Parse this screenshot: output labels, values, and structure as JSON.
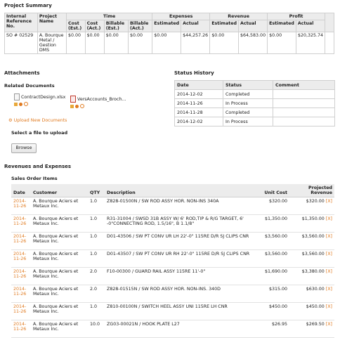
{
  "project_summary": {
    "title": "Project Summary",
    "group_headers": {
      "time": "Time",
      "expenses": "Expenses",
      "revenue": "Revenue",
      "profit": "Profit"
    },
    "columns": [
      "Internal Reference No.",
      "Project Name",
      "Cost (Est.)",
      "Cost (Act.)",
      "Billable (Est.)",
      "Billable (Act.)",
      "Estimated",
      "Actual",
      "Estimated",
      "Actual",
      "Estimated",
      "Actual"
    ],
    "row": [
      "SO # 02529",
      "A. Bourque Metal / Gestion DMS",
      "$0.00",
      "$0.00",
      "$0.00",
      "$0.00",
      "$0.00",
      "$44,257.26",
      "$0.00",
      "$64,583.00",
      "$0.00",
      "$20,325.74"
    ]
  },
  "attachments": {
    "title": "Attachments",
    "related_label": "Related Documents",
    "docs": [
      "ContractDesign.xlsx",
      "VersAccounts_Broch..."
    ],
    "upload_link": "Upload New Documents",
    "select_label": "Select a file to upload",
    "browse_label": "Browse"
  },
  "status_history": {
    "title": "Status History",
    "columns": [
      "Date",
      "Status",
      "Comment"
    ],
    "rows": [
      [
        "2014-12-02",
        "Completed",
        ""
      ],
      [
        "2014-11-26",
        "In Process",
        ""
      ],
      [
        "2014-11-28",
        "Completed",
        ""
      ],
      [
        "2014-12-02",
        "In Process",
        ""
      ]
    ]
  },
  "revenues": {
    "title": "Revenues and Expenses",
    "sales_title": "Sales Order Items",
    "columns": [
      "Date",
      "Customer",
      "QTY",
      "Description",
      "Unit Cost",
      "Projected Revenue"
    ],
    "remove_label": "[X]",
    "rows": [
      {
        "date": "2014-11-26",
        "customer": "A. Bourque Aciers et Metaux Inc.",
        "qty": "1.0",
        "desc": "Z828-01500N / SW ROD ASSY HOR. NON-INS 340A",
        "unit": "$320.00",
        "rev": "$320.00"
      },
      {
        "date": "2014-11-26",
        "customer": "A. Bourque Aciers et Metaux Inc.",
        "qty": "1.0",
        "desc": "R31-31004 / SWSD 31B ASSY W/ 6' ROD,TIP & R/G TARGET, 6' -0\"CONNECTING ROD, 1.5/16\", B 1.1/8\"",
        "unit": "$1,350.00",
        "rev": "$1,350.00"
      },
      {
        "date": "2014-11-26",
        "customer": "A. Bourque Aciers et Metaux Inc.",
        "qty": "1.0",
        "desc": "D01-43506 / SW PT CONV UR LH 22'-0\" 115RE D/R SJ CLIPS CNR",
        "unit": "$3,560.00",
        "rev": "$3,560.00"
      },
      {
        "date": "2014-11-26",
        "customer": "A. Bourque Aciers et Metaux Inc.",
        "qty": "1.0",
        "desc": "D01-43507 / SW PT CONV UR RH 22'-0\" 115RE D/R SJ CLIPS CNR",
        "unit": "$3,560.00",
        "rev": "$3,560.00"
      },
      {
        "date": "2014-11-26",
        "customer": "A. Bourque Aciers et Metaux Inc.",
        "qty": "2.0",
        "desc": "F10-00300 / GUARD RAIL ASSY 115RE 11'-0\"",
        "unit": "$1,690.00",
        "rev": "$3,380.00"
      },
      {
        "date": "2014-11-26",
        "customer": "A. Bourque Aciers et Metaux Inc.",
        "qty": "2.0",
        "desc": "Z828-01515N / SW ROD ASSY HOR. NON-INS. 340D",
        "unit": "$315.00",
        "rev": "$630.00"
      },
      {
        "date": "2014-11-26",
        "customer": "A. Bourque Aciers et Metaux Inc.",
        "qty": "1.0",
        "desc": "Z810-00100N / SWITCH HEEL ASSY UNI 115RE LH CNR",
        "unit": "$450.00",
        "rev": "$450.00"
      },
      {
        "date": "2014-11-26",
        "customer": "A. Bourque Aciers et Metaux Inc.",
        "qty": "10.0",
        "desc": "ZG03-00021N / HOOK PLATE L27",
        "unit": "$26.95",
        "rev": "$269.50"
      }
    ]
  }
}
